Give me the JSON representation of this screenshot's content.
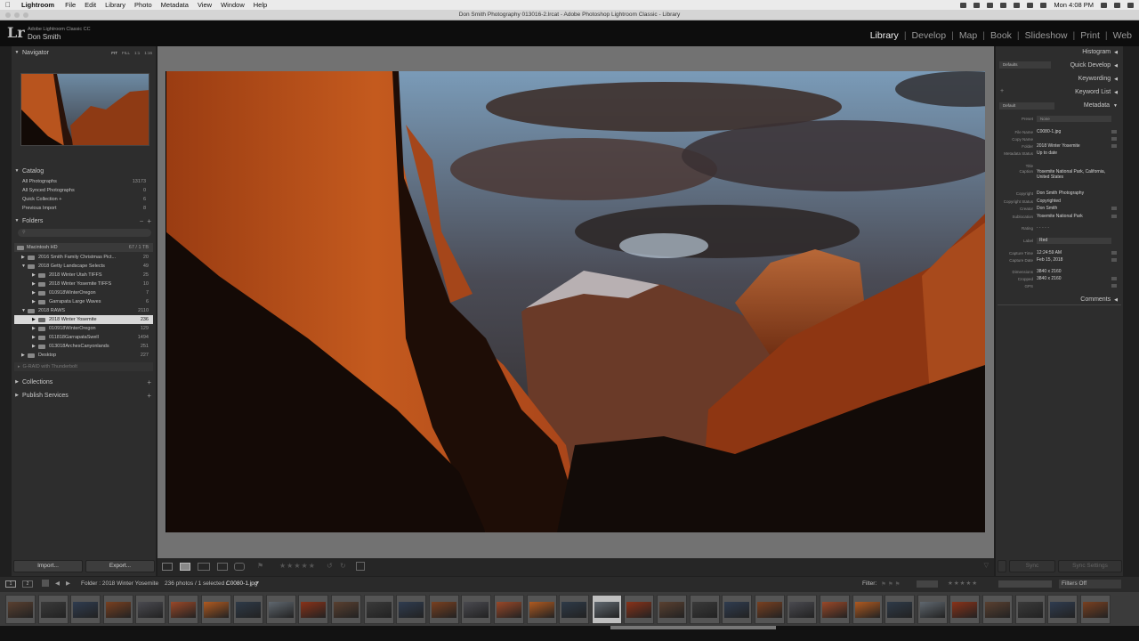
{
  "menubar": {
    "app": "Lightroom",
    "items": [
      "File",
      "Edit",
      "Library",
      "Photo",
      "Metadata",
      "View",
      "Window",
      "Help"
    ],
    "clock": "Mon 4:08 PM"
  },
  "window": {
    "title": "Don Smith Photography 013016-2.lrcat - Adobe Photoshop Lightroom Classic - Library"
  },
  "identity": {
    "product": "Adobe Lightroom Classic CC",
    "user": "Don Smith",
    "logo": "Lr"
  },
  "modules": {
    "items": [
      "Library",
      "Develop",
      "Map",
      "Book",
      "Slideshow",
      "Print",
      "Web"
    ],
    "active": "Library"
  },
  "navigator": {
    "title": "Navigator",
    "zoom": [
      "FIT",
      "FILL",
      "1:1",
      "1:16"
    ]
  },
  "catalog": {
    "title": "Catalog",
    "items": [
      {
        "label": "All Photographs",
        "count": "13173"
      },
      {
        "label": "All Synced Photographs",
        "count": "0"
      },
      {
        "label": "Quick Collection +",
        "count": "6"
      },
      {
        "label": "Previous Import",
        "count": "8"
      }
    ]
  },
  "folders": {
    "title": "Folders",
    "volume": "Macintosh HD",
    "volume_stat": "67 / 1 TB",
    "items": [
      {
        "label": "2016 Smith Family Christmas Pict...",
        "count": "20"
      },
      {
        "label": "2018 Getty Landscape Selects",
        "count": "49"
      },
      {
        "label": "2018 Winter Utah TIFFS",
        "count": "25"
      },
      {
        "label": "2018 Winter Yosemite TIFFS",
        "count": "10"
      },
      {
        "label": "010918WinterOregon",
        "count": "7"
      },
      {
        "label": "Garrapata Large Waves",
        "count": "6"
      },
      {
        "label": "2018 RAWS",
        "count": "2110"
      },
      {
        "label": "2018 Winter Yosemite",
        "count": "236"
      },
      {
        "label": "010918WinterOregon",
        "count": "129"
      },
      {
        "label": "011818GarrapataSwell",
        "count": "1494"
      },
      {
        "label": "013018ArchesCanyonlands",
        "count": "251"
      },
      {
        "label": "Desktop",
        "count": "227"
      }
    ],
    "drive": "G-RAID with Thunderbolt"
  },
  "collections": {
    "title": "Collections"
  },
  "publish": {
    "title": "Publish Services"
  },
  "buttons": {
    "import": "Import...",
    "export": "Export...",
    "sync": "Sync",
    "sync_settings": "Sync Settings"
  },
  "right": {
    "histogram": "Histogram",
    "quick_develop": "Quick Develop",
    "defaults": "Defaults",
    "keywording": "Keywording",
    "keyword_list": "Keyword List",
    "metadata": "Metadata",
    "default": "Default",
    "preset_label": "Preset",
    "preset_value": "None",
    "comments": "Comments",
    "fields": [
      {
        "label": "File Name",
        "value": "C0080-1.jpg"
      },
      {
        "label": "Copy Name",
        "value": ""
      },
      {
        "label": "Folder",
        "value": "2018 Winter Yosemite"
      },
      {
        "label": "Metadata Status",
        "value": "Up to date"
      },
      {
        "label": "Title",
        "value": ""
      },
      {
        "label": "Caption",
        "value": "Yosemite National Park, California, United States"
      },
      {
        "label": "Copyright",
        "value": "Don Smith Photography"
      },
      {
        "label": "Copyright Status",
        "value": "Copyrighted"
      },
      {
        "label": "Creator",
        "value": "Don Smith"
      },
      {
        "label": "Sublocation",
        "value": "Yosemite National Park"
      },
      {
        "label": "Rating",
        "value": "· · · · ·"
      },
      {
        "label": "Label",
        "value": "Red"
      },
      {
        "label": "Capture Time",
        "value": "12:24:59 AM"
      },
      {
        "label": "Capture Date",
        "value": "Feb 15, 2018"
      },
      {
        "label": "Dimensions",
        "value": "3840 x 2160"
      },
      {
        "label": "Cropped",
        "value": "3840 x 2160"
      },
      {
        "label": "GPS",
        "value": ""
      }
    ]
  },
  "filmheader": {
    "pages": [
      "1",
      "2"
    ],
    "source": "Folder : 2018 Winter Yosemite",
    "status": "236 photos / 1 selected /",
    "selected": "C0080-1.jpg",
    "filter": "Filter:",
    "filters_off": "Filters Off"
  },
  "filmstrip": {
    "count": 34,
    "selected_index": 18
  }
}
